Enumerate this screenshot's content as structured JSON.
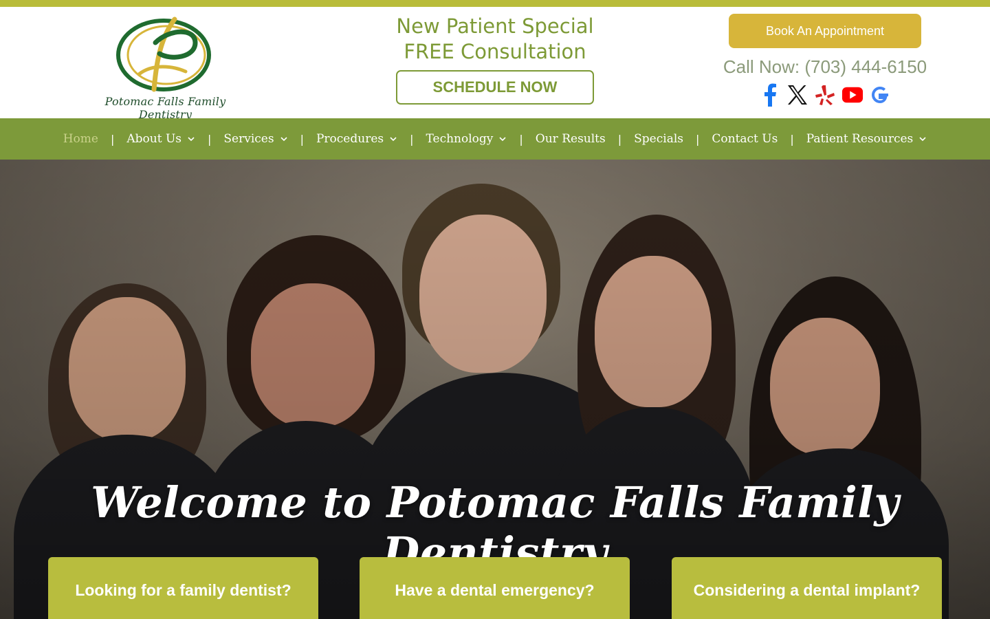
{
  "brand": {
    "logo_text": "Potomac Falls Family Dentistry",
    "colors": {
      "green": "#7d9a3a",
      "gold": "#d7b53a",
      "card": "#b8bd3e",
      "logo_green": "#1f6b2f"
    }
  },
  "promo": {
    "line1": "New Patient Special",
    "line2": "FREE Consultation",
    "button": "SCHEDULE NOW"
  },
  "contact": {
    "book_label": "Book An Appointment",
    "call_text": "Call Now: (703) 444-6150"
  },
  "socials": [
    {
      "name": "facebook-icon",
      "color": "#1877f2"
    },
    {
      "name": "x-icon",
      "color": "#111111"
    },
    {
      "name": "yelp-icon",
      "color": "#d32323"
    },
    {
      "name": "youtube-icon",
      "color": "#ff0000"
    },
    {
      "name": "google-icon",
      "color": "#4285f4"
    }
  ],
  "nav": {
    "items": [
      {
        "label": "Home",
        "dropdown": false,
        "active": true
      },
      {
        "label": "About Us",
        "dropdown": true
      },
      {
        "label": "Services",
        "dropdown": true
      },
      {
        "label": "Procedures",
        "dropdown": true
      },
      {
        "label": "Technology",
        "dropdown": true
      },
      {
        "label": "Our Results",
        "dropdown": false
      },
      {
        "label": "Specials",
        "dropdown": false
      },
      {
        "label": "Contact Us",
        "dropdown": false
      },
      {
        "label": "Patient Resources",
        "dropdown": true
      }
    ],
    "separator": "|"
  },
  "hero": {
    "title": "Welcome to Potomac Falls Family Dentistry",
    "cards": [
      {
        "label": "Looking for a family dentist?"
      },
      {
        "label": "Have a dental emergency?"
      },
      {
        "label": "Considering a dental implant?"
      }
    ]
  }
}
